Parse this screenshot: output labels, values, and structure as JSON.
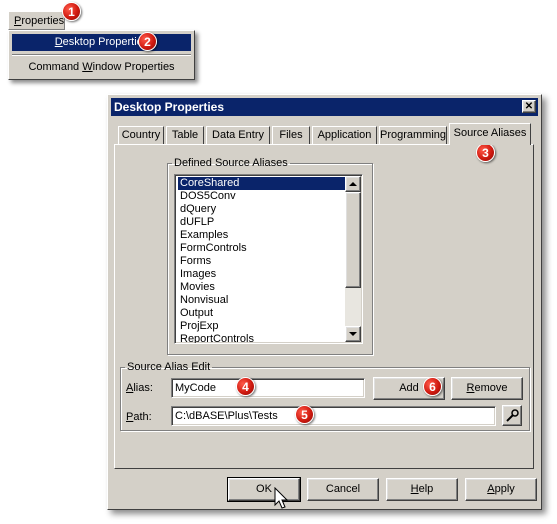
{
  "menubar": {
    "properties_label": "Properties",
    "properties_underline": "P",
    "properties_rest": "roperties"
  },
  "dropdown": {
    "items": [
      {
        "label_pre": "",
        "label_ul": "D",
        "label_post": "esktop Properties"
      },
      {
        "label_pre": "Command ",
        "label_ul": "W",
        "label_post": "indow Properties"
      }
    ]
  },
  "dialog": {
    "title": "Desktop Properties",
    "close_glyph": "✕",
    "tabs": [
      "Country",
      "Table",
      "Data Entry",
      "Files",
      "Application",
      "Programming",
      "Source Aliases"
    ],
    "defined_aliases_legend": "Defined Source Aliases",
    "aliases": [
      "CoreShared",
      "DOS5Conv",
      "dQuery",
      "dUFLP",
      "Examples",
      "FormControls",
      "Forms",
      "Images",
      "Movies",
      "Nonvisual",
      "Output",
      "ProjExp",
      "ReportControls"
    ],
    "alias_edit_legend": "Source Alias Edit",
    "alias_label_ul": "A",
    "alias_label_rest": "lias:",
    "alias_value": "MyCode",
    "path_label_ul": "P",
    "path_label_rest": "ath:",
    "path_value": "C:\\dBASE\\Plus\\Tests",
    "add_button": "Add",
    "remove_ul": "R",
    "remove_rest": "emove",
    "ok_button": "OK",
    "cancel_button": "Cancel",
    "help_ul": "H",
    "help_rest": "elp",
    "apply_ul": "A",
    "apply_rest": "pply"
  },
  "callouts": [
    "1",
    "2",
    "3",
    "4",
    "5",
    "6"
  ],
  "colors": {
    "titlebar": "#0a246a",
    "face": "#d4d0c8",
    "badge": "#d01a10"
  }
}
